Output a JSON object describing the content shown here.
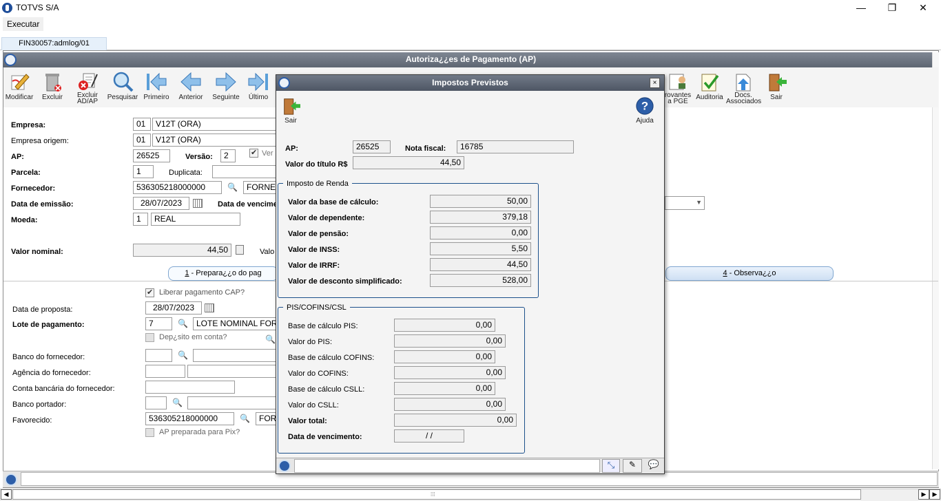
{
  "window": {
    "title": "TOTVS S/A",
    "minimize": "—",
    "maximize": "❐",
    "close": "✕"
  },
  "menu": {
    "executar": "Executar"
  },
  "tab": {
    "label": "FIN30057:admlog/01"
  },
  "main": {
    "title": "Autoriza¿¿es de Pagamento (AP)"
  },
  "toolbar": {
    "modificar": "Modificar",
    "excluir": "Excluir",
    "excluir_ad1": "Excluir",
    "excluir_ad2": "AD/AP",
    "pesquisar": "Pesquisar",
    "primeiro": "Primeiro",
    "anterior": "Anterior",
    "seguinte": "Seguinte",
    "ultimo": "Último",
    "comprovantes1": "rovantes",
    "comprovantes2": "a PGE",
    "auditoria": "Auditoria",
    "docs1": "Docs.",
    "docs2": "Associados",
    "sair": "Sair"
  },
  "form": {
    "empresa_label": "Empresa:",
    "empresa_code": "01",
    "empresa_name": "V12T (ORA)",
    "empresa_origem_label": "Empresa origem:",
    "empresa_origem_code": "01",
    "empresa_origem_name": "V12T (ORA)",
    "ap_label": "AP:",
    "ap_value": "26525",
    "versao_label": "Versão:",
    "versao_value": "2",
    "versao_chk_label": "Ver",
    "parcela_label": "Parcela:",
    "parcela_value": "1",
    "duplicata_label": "Duplicata:",
    "fornecedor_label": "Fornecedor:",
    "fornecedor_code": "536305218000000",
    "fornecedor_name": "FORNEC",
    "data_emissao_label": "Data de emissão:",
    "data_emissao_value": "28/07/2023",
    "data_venc_label": "Data de vencimen",
    "moeda_label": "Moeda:",
    "moeda_code": "1",
    "moeda_name": "REAL",
    "valor_nominal_label": "Valor nominal:",
    "valor_nominal_value": "44,50",
    "valor_label2": "Valo"
  },
  "folders": {
    "f1_key": "1",
    "f1_text": " - Prepara¿¿o do pag",
    "f4_key": "4",
    "f4_text": " - Observa¿¿o"
  },
  "prep": {
    "liberar_label": "Liberar pagamento CAP?",
    "data_proposta_label": "Data de proposta:",
    "data_proposta_value": "28/07/2023",
    "lote_label": "Lote de pagamento:",
    "lote_code": "7",
    "lote_name": "LOTE NOMINAL FORNEC",
    "deposito_label": "Dep¿sito em conta?",
    "banco_forn_label": "Banco do fornecedor:",
    "agencia_label": "Agência do fornecedor:",
    "conta_label": "Conta bancária do fornecedor:",
    "banco_portador_label": "Banco portador:",
    "favorecido_label": "Favorecido:",
    "favorecido_code": "536305218000000",
    "favorecido_name": "FORN",
    "pix_label": "AP preparada para Pix?"
  },
  "dialog": {
    "title": "Impostos Previstos",
    "close": "×",
    "sair": "Sair",
    "ajuda": "Ajuda",
    "ap_label": "AP:",
    "ap_value": "26525",
    "nf_label": "Nota fiscal:",
    "nf_value": "16785",
    "valor_titulo_label": "Valor do título R$",
    "valor_titulo_value": "44,50",
    "ir_group": "Imposto de Renda",
    "ir_rows": [
      {
        "label": "Valor da base de cálculo:",
        "value": "50,00"
      },
      {
        "label": "Valor de dependente:",
        "value": "379,18"
      },
      {
        "label": "Valor de pensão:",
        "value": "0,00"
      },
      {
        "label": "Valor de INSS:",
        "value": "5,50"
      },
      {
        "label": "Valor de IRRF:",
        "value": "44,50"
      },
      {
        "label": "Valor de desconto simplificado:",
        "value": "528,00"
      }
    ],
    "pis_group": "PIS/COFINS/CSL",
    "pis_rows": [
      {
        "label": "Base de cálculo PIS:",
        "value": "0,00"
      },
      {
        "label": "Valor do PIS:",
        "value": "0,00"
      },
      {
        "label": "Base de cálculo COFINS:",
        "value": "0,00"
      },
      {
        "label": "Valor do COFINS:",
        "value": "0,00"
      },
      {
        "label": "Base de cálculo CSLL:",
        "value": "0,00"
      },
      {
        "label": "Valor do CSLL:",
        "value": "0,00"
      },
      {
        "label": "Valor total:",
        "value": "0,00"
      },
      {
        "label": "Data de vencimento:",
        "value": " /  /"
      }
    ]
  },
  "colors": {
    "accent": "#2d5ea8",
    "header": "#6b737f",
    "group_border": "#1a4f8a"
  }
}
